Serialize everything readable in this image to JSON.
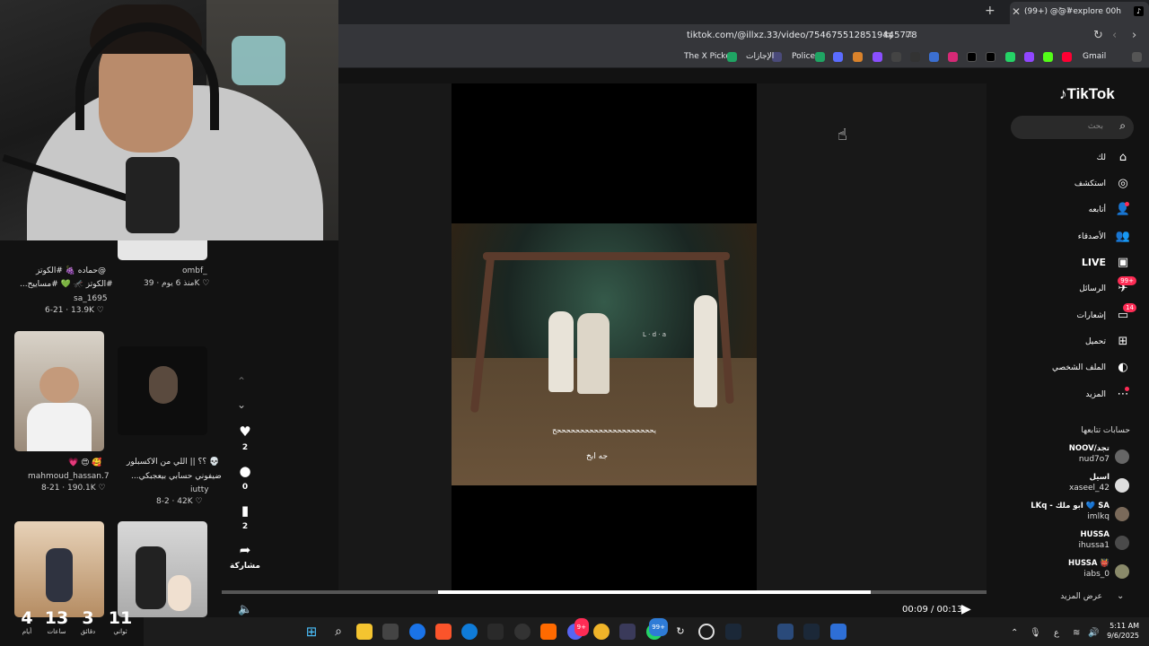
{
  "browser": {
    "tab_title": "(99+) @ًًً@ًًً#explore 00⁦h",
    "tab_favicon": "tiktok-icon",
    "url": "tiktok.com/@illxz.33/video/7546755128519445778",
    "bookmarks": [
      "Gmail",
      "Police",
      "الإجازات",
      "The X Picker"
    ]
  },
  "left_panel": {
    "top_caption_left": "@حماده 🍇 #الكوتز",
    "top_caption_left_2": "#الكوتز 🦟 💚 #مساييح...",
    "top_user_left": "sa_1695",
    "top_meta_left": "6-21 · 13.9K ♡",
    "top_user_right": "ombf_",
    "top_meta_right": "منذ 6 يوم · 39K ♡",
    "mid_caption_left": "🥰 😍 💗",
    "mid_user_left": "mahmoud_hassan.7",
    "mid_meta_left": "8-21 · 190.1K ♡",
    "mid_caption_right": "💀 ؟؟ || اللي من الاكسبلور",
    "mid_caption_right_2": "ضيفوني حسابي بيعجبكي...",
    "mid_user_right": "iutty",
    "mid_meta_right": "8-2 · 42K ♡"
  },
  "video": {
    "caption_line": "يحححححححححححححححححححححح",
    "caption_sub": "جه ابخ",
    "watermark": "L · d · a",
    "time": "00:09 / 00:13",
    "progress": 0.28
  },
  "actions": {
    "likes": "2",
    "comments": "0",
    "saves": "2",
    "share_label": "مشاركة"
  },
  "sidebar": {
    "logo": "TikTok",
    "search_placeholder": "بحث",
    "nav": [
      {
        "label": "لك",
        "icon": "home-icon"
      },
      {
        "label": "استكشف",
        "icon": "compass-icon"
      },
      {
        "label": "أتابعه",
        "icon": "user-plus-icon"
      },
      {
        "label": "الأصدقاء",
        "icon": "friends-icon"
      },
      {
        "label": "LIVE",
        "icon": "live-tv-icon"
      },
      {
        "label": "الرسائل",
        "icon": "messages-icon",
        "badge": "99+"
      },
      {
        "label": "إشعارات",
        "icon": "inbox-icon",
        "badge": "14"
      },
      {
        "label": "تحميل",
        "icon": "upload-icon"
      },
      {
        "label": "الملف الشخصي",
        "icon": "profile-icon"
      },
      {
        "label": "المزيد",
        "icon": "more-icon"
      }
    ],
    "following_title": "حسابات تتابعها",
    "accounts": [
      {
        "name": "NOOV/تجد",
        "user": "nud7o7"
      },
      {
        "name": "اسيل",
        "user": "xaseel_42"
      },
      {
        "name": "LKq - ابو ملك 💙 SA",
        "user": "imlkq"
      },
      {
        "name": "HUSSA",
        "user": "ihussa1"
      },
      {
        "name": "HUSSA 👹",
        "user": "iabs_0"
      }
    ],
    "see_more": "عرض المزيد"
  },
  "countdown": [
    {
      "value": "4",
      "label": "أيام"
    },
    {
      "value": "13",
      "label": "ساعات"
    },
    {
      "value": "3",
      "label": "دقائق"
    },
    {
      "value": "11",
      "label": "ثواني"
    }
  ],
  "taskbar": {
    "time": "5:11 AM",
    "date": "9/6/2025",
    "lang": "ع",
    "discord_badge": "9+",
    "whatsapp_badge": "99+"
  },
  "colors": {
    "accent": "#fe2c55",
    "background": "#121212"
  }
}
